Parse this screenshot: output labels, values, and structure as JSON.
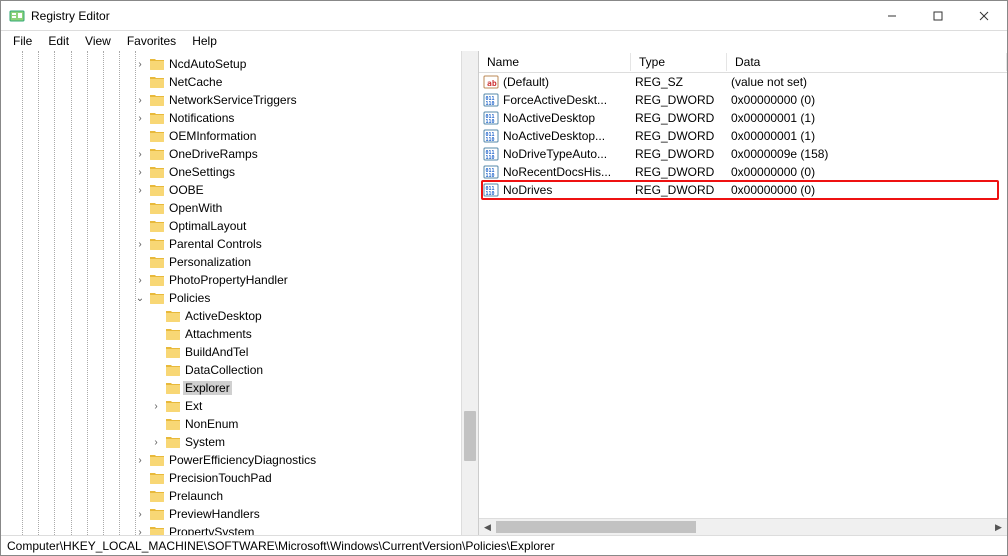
{
  "window": {
    "title": "Registry Editor"
  },
  "menu": {
    "file": "File",
    "edit": "Edit",
    "view": "View",
    "favorites": "Favorites",
    "help": "Help"
  },
  "tree": {
    "guide_xs": [
      21,
      37,
      53,
      70,
      86,
      102,
      118,
      134
    ],
    "rows": [
      {
        "indent": 8,
        "exp": ">",
        "name": "NcdAutoSetup"
      },
      {
        "indent": 8,
        "exp": "",
        "name": "NetCache"
      },
      {
        "indent": 8,
        "exp": ">",
        "name": "NetworkServiceTriggers"
      },
      {
        "indent": 8,
        "exp": ">",
        "name": "Notifications"
      },
      {
        "indent": 8,
        "exp": "",
        "name": "OEMInformation"
      },
      {
        "indent": 8,
        "exp": ">",
        "name": "OneDriveRamps"
      },
      {
        "indent": 8,
        "exp": ">",
        "name": "OneSettings"
      },
      {
        "indent": 8,
        "exp": ">",
        "name": "OOBE"
      },
      {
        "indent": 8,
        "exp": "",
        "name": "OpenWith"
      },
      {
        "indent": 8,
        "exp": "",
        "name": "OptimalLayout"
      },
      {
        "indent": 8,
        "exp": ">",
        "name": "Parental Controls"
      },
      {
        "indent": 8,
        "exp": "",
        "name": "Personalization"
      },
      {
        "indent": 8,
        "exp": ">",
        "name": "PhotoPropertyHandler"
      },
      {
        "indent": 8,
        "exp": "v",
        "name": "Policies"
      },
      {
        "indent": 9,
        "exp": "",
        "name": "ActiveDesktop"
      },
      {
        "indent": 9,
        "exp": "",
        "name": "Attachments"
      },
      {
        "indent": 9,
        "exp": "",
        "name": "BuildAndTel"
      },
      {
        "indent": 9,
        "exp": "",
        "name": "DataCollection"
      },
      {
        "indent": 9,
        "exp": "",
        "name": "Explorer",
        "selected": true
      },
      {
        "indent": 9,
        "exp": ">",
        "name": "Ext"
      },
      {
        "indent": 9,
        "exp": "",
        "name": "NonEnum"
      },
      {
        "indent": 9,
        "exp": ">",
        "name": "System"
      },
      {
        "indent": 8,
        "exp": ">",
        "name": "PowerEfficiencyDiagnostics"
      },
      {
        "indent": 8,
        "exp": "",
        "name": "PrecisionTouchPad"
      },
      {
        "indent": 8,
        "exp": "",
        "name": "Prelaunch"
      },
      {
        "indent": 8,
        "exp": ">",
        "name": "PreviewHandlers"
      },
      {
        "indent": 8,
        "exp": ">",
        "name": "PropertySystem"
      }
    ]
  },
  "list": {
    "header": {
      "name": "Name",
      "type": "Type",
      "data": "Data"
    },
    "rows": [
      {
        "icon": "sz",
        "name": "(Default)",
        "type": "REG_SZ",
        "data": "(value not set)"
      },
      {
        "icon": "dw",
        "name": "ForceActiveDeskt...",
        "type": "REG_DWORD",
        "data": "0x00000000 (0)"
      },
      {
        "icon": "dw",
        "name": "NoActiveDesktop",
        "type": "REG_DWORD",
        "data": "0x00000001 (1)"
      },
      {
        "icon": "dw",
        "name": "NoActiveDesktop...",
        "type": "REG_DWORD",
        "data": "0x00000001 (1)"
      },
      {
        "icon": "dw",
        "name": "NoDriveTypeAuto...",
        "type": "REG_DWORD",
        "data": "0x0000009e (158)"
      },
      {
        "icon": "dw",
        "name": "NoRecentDocsHis...",
        "type": "REG_DWORD",
        "data": "0x00000000 (0)"
      },
      {
        "icon": "dw",
        "name": "NoDrives",
        "type": "REG_DWORD",
        "data": "0x00000000 (0)",
        "hl": true
      }
    ]
  },
  "statusbar": "Computer\\HKEY_LOCAL_MACHINE\\SOFTWARE\\Microsoft\\Windows\\CurrentVersion\\Policies\\Explorer"
}
